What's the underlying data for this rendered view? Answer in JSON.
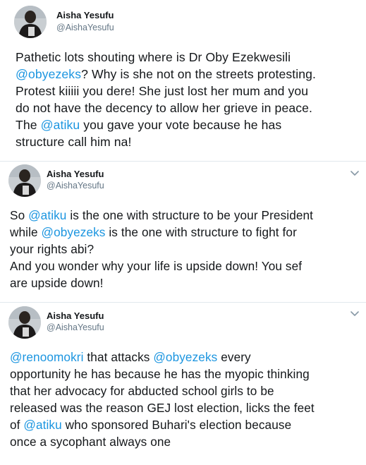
{
  "tweets": [
    {
      "author": {
        "name": "Aisha Yesufu",
        "handle": "@AishaYesufu"
      },
      "has_menu": false,
      "lines": [
        [
          {
            "t": "Pathetic lots shouting where is Dr Oby Ezekwesili"
          }
        ],
        [
          {
            "t": "@obyezeks",
            "m": true
          },
          {
            "t": "? Why is she not on the streets protesting."
          }
        ],
        [
          {
            "t": "Protest kiiiii you dere! She just lost her mum and you"
          }
        ],
        [
          {
            "t": "do not have the decency to allow her grieve in peace."
          }
        ],
        [
          {
            "t": "The "
          },
          {
            "t": "@atiku",
            "m": true
          },
          {
            "t": " you gave your vote because he has"
          }
        ],
        [
          {
            "t": "structure call him na!"
          }
        ]
      ]
    },
    {
      "author": {
        "name": "Aisha Yesufu",
        "handle": "@AishaYesufu"
      },
      "has_menu": true,
      "lines": [
        [
          {
            "t": "So "
          },
          {
            "t": "@atiku",
            "m": true
          },
          {
            "t": " is the one with structure to be your President"
          }
        ],
        [
          {
            "t": "while "
          },
          {
            "t": "@obyezeks",
            "m": true
          },
          {
            "t": " is the one with structure to fight for"
          }
        ],
        [
          {
            "t": "your rights abi?"
          }
        ],
        [
          {
            "t": "And you wonder why your life is upside down! You sef"
          }
        ],
        [
          {
            "t": "are upside down!"
          }
        ]
      ]
    },
    {
      "author": {
        "name": "Aisha Yesufu",
        "handle": "@AishaYesufu"
      },
      "has_menu": true,
      "lines": [
        [
          {
            "t": "@renoomokri",
            "m": true
          },
          {
            "t": " that attacks "
          },
          {
            "t": "@obyezeks",
            "m": true
          },
          {
            "t": " every"
          }
        ],
        [
          {
            "t": "opportunity he has because he has the myopic thinking"
          }
        ],
        [
          {
            "t": "that her advocacy for abducted school girls to be"
          }
        ],
        [
          {
            "t": "released was the reason GEJ lost election, licks the feet"
          }
        ],
        [
          {
            "t": "of "
          },
          {
            "t": "@atiku",
            "m": true
          },
          {
            "t": " who sponsored Buhari's election because"
          }
        ],
        [
          {
            "t": "once a sycophant always one"
          }
        ]
      ]
    }
  ],
  "colors": {
    "mention": "#1b95e0",
    "handle": "#657786",
    "text": "#14171a",
    "divider": "#e1e8ed"
  },
  "icons": {
    "avatar": "profile-photo",
    "menu": "chevron-down-icon"
  }
}
